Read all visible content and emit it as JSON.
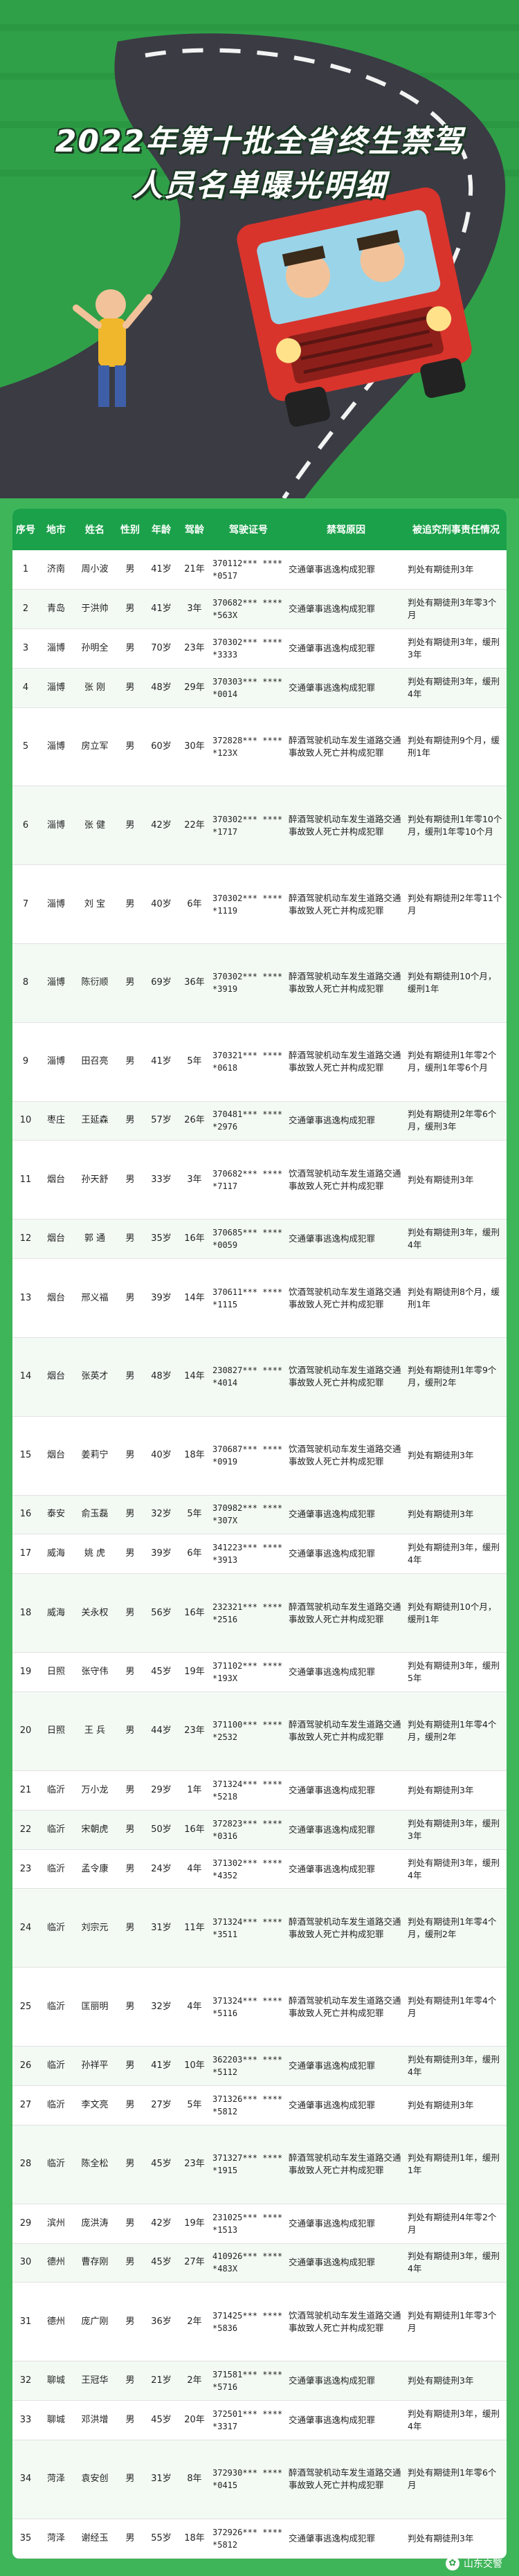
{
  "title": {
    "line1": "2022年第十批全省终生禁驾",
    "line2": "人员名单曝光明细"
  },
  "headers": [
    "序号",
    "地市",
    "姓名",
    "性别",
    "年龄",
    "驾龄",
    "驾驶证号",
    "禁驾原因",
    "被追究刑事责任情况"
  ],
  "rows": [
    [
      "1",
      "济南",
      "周小波",
      "男",
      "41岁",
      "21年",
      "370112*** *****0517",
      "交通肇事逃逸构成犯罪",
      "判处有期徒刑3年"
    ],
    [
      "2",
      "青岛",
      "于洪帅",
      "男",
      "41岁",
      "3年",
      "370682*** *****563X",
      "交通肇事逃逸构成犯罪",
      "判处有期徒刑3年零3个月"
    ],
    [
      "3",
      "淄博",
      "孙明全",
      "男",
      "70岁",
      "23年",
      "370302*** *****3333",
      "交通肇事逃逸构成犯罪",
      "判处有期徒刑3年，缓刑3年"
    ],
    [
      "4",
      "淄博",
      "张 刚",
      "男",
      "48岁",
      "29年",
      "370303*** *****0014",
      "交通肇事逃逸构成犯罪",
      "判处有期徒刑3年，缓刑4年"
    ],
    [
      "5",
      "淄博",
      "房立军",
      "男",
      "60岁",
      "30年",
      "372828*** *****123X",
      "醉酒驾驶机动车发生道路交通事故致人死亡并构成犯罪",
      "判处有期徒刑9个月，缓刑1年"
    ],
    [
      "6",
      "淄博",
      "张 健",
      "男",
      "42岁",
      "22年",
      "370302*** *****1717",
      "醉酒驾驶机动车发生道路交通事故致人死亡并构成犯罪",
      "判处有期徒刑1年零10个月，缓刑1年零10个月"
    ],
    [
      "7",
      "淄博",
      "刘 宝",
      "男",
      "40岁",
      "6年",
      "370302*** *****1119",
      "醉酒驾驶机动车发生道路交通事故致人死亡并构成犯罪",
      "判处有期徒刑2年零11个月"
    ],
    [
      "8",
      "淄博",
      "陈衍顺",
      "男",
      "69岁",
      "36年",
      "370302*** *****3919",
      "醉酒驾驶机动车发生道路交通事故致人死亡并构成犯罪",
      "判处有期徒刑10个月，缓刑1年"
    ],
    [
      "9",
      "淄博",
      "田召亮",
      "男",
      "41岁",
      "5年",
      "370321*** *****0618",
      "醉酒驾驶机动车发生道路交通事故致人死亡并构成犯罪",
      "判处有期徒刑1年零2个月，缓刑1年零6个月"
    ],
    [
      "10",
      "枣庄",
      "王延森",
      "男",
      "57岁",
      "26年",
      "370481*** *****2976",
      "交通肇事逃逸构成犯罪",
      "判处有期徒刑2年零6个月，缓刑3年"
    ],
    [
      "11",
      "烟台",
      "孙天舒",
      "男",
      "33岁",
      "3年",
      "370682*** *****7117",
      "饮酒驾驶机动车发生道路交通事故致人死亡并构成犯罪",
      "判处有期徒刑3年"
    ],
    [
      "12",
      "烟台",
      "郭 通",
      "男",
      "35岁",
      "16年",
      "370685*** *****0059",
      "交通肇事逃逸构成犯罪",
      "判处有期徒刑3年，缓刑4年"
    ],
    [
      "13",
      "烟台",
      "邢义福",
      "男",
      "39岁",
      "14年",
      "370611*** *****1115",
      "饮酒驾驶机动车发生道路交通事故致人死亡并构成犯罪",
      "判处有期徒刑8个月，缓刑1年"
    ],
    [
      "14",
      "烟台",
      "张英才",
      "男",
      "48岁",
      "14年",
      "230827*** *****4014",
      "饮酒驾驶机动车发生道路交通事故致人死亡并构成犯罪",
      "判处有期徒刑1年零9个月，缓刑2年"
    ],
    [
      "15",
      "烟台",
      "姜莉宁",
      "男",
      "40岁",
      "18年",
      "370687*** *****0919",
      "饮酒驾驶机动车发生道路交通事故致人死亡并构成犯罪",
      "判处有期徒刑3年"
    ],
    [
      "16",
      "泰安",
      "俞玉磊",
      "男",
      "32岁",
      "5年",
      "370982*** *****307X",
      "交通肇事逃逸构成犯罪",
      "判处有期徒刑3年"
    ],
    [
      "17",
      "威海",
      "姚 虎",
      "男",
      "39岁",
      "6年",
      "341223*** *****3913",
      "交通肇事逃逸构成犯罪",
      "判处有期徒刑3年，缓刑4年"
    ],
    [
      "18",
      "威海",
      "关永权",
      "男",
      "56岁",
      "16年",
      "232321*** *****2516",
      "醉酒驾驶机动车发生道路交通事故致人死亡并构成犯罪",
      "判处有期徒刑10个月，缓刑1年"
    ],
    [
      "19",
      "日照",
      "张守伟",
      "男",
      "45岁",
      "19年",
      "371102*** *****193X",
      "交通肇事逃逸构成犯罪",
      "判处有期徒刑3年，缓刑5年"
    ],
    [
      "20",
      "日照",
      "王 兵",
      "男",
      "44岁",
      "23年",
      "371100*** *****2532",
      "醉酒驾驶机动车发生道路交通事故致人死亡并构成犯罪",
      "判处有期徒刑1年零4个月，缓刑2年"
    ],
    [
      "21",
      "临沂",
      "万小龙",
      "男",
      "29岁",
      "1年",
      "371324*** *****5218",
      "交通肇事逃逸构成犯罪",
      "判处有期徒刑3年"
    ],
    [
      "22",
      "临沂",
      "宋朝虎",
      "男",
      "50岁",
      "16年",
      "372823*** *****0316",
      "交通肇事逃逸构成犯罪",
      "判处有期徒刑3年，缓刑3年"
    ],
    [
      "23",
      "临沂",
      "孟令康",
      "男",
      "24岁",
      "4年",
      "371302*** *****4352",
      "交通肇事逃逸构成犯罪",
      "判处有期徒刑3年，缓刑4年"
    ],
    [
      "24",
      "临沂",
      "刘宗元",
      "男",
      "31岁",
      "11年",
      "371324*** *****3511",
      "醉酒驾驶机动车发生道路交通事故致人死亡并构成犯罪",
      "判处有期徒刑1年零4个月，缓刑2年"
    ],
    [
      "25",
      "临沂",
      "匡丽明",
      "男",
      "32岁",
      "4年",
      "371324*** *****5116",
      "醉酒驾驶机动车发生道路交通事故致人死亡并构成犯罪",
      "判处有期徒刑1年零4个月"
    ],
    [
      "26",
      "临沂",
      "孙祥平",
      "男",
      "41岁",
      "10年",
      "362203*** *****5112",
      "交通肇事逃逸构成犯罪",
      "判处有期徒刑3年，缓刑4年"
    ],
    [
      "27",
      "临沂",
      "李文亮",
      "男",
      "27岁",
      "5年",
      "371326*** *****5812",
      "交通肇事逃逸构成犯罪",
      "判处有期徒刑3年"
    ],
    [
      "28",
      "临沂",
      "陈全松",
      "男",
      "45岁",
      "23年",
      "371327*** *****1915",
      "醉酒驾驶机动车发生道路交通事故致人死亡并构成犯罪",
      "判处有期徒刑1年，缓刑1年"
    ],
    [
      "29",
      "滨州",
      "庞洪涛",
      "男",
      "42岁",
      "19年",
      "231025*** *****1513",
      "交通肇事逃逸构成犯罪",
      "判处有期徒刑4年零2个月"
    ],
    [
      "30",
      "德州",
      "曹存刚",
      "男",
      "45岁",
      "27年",
      "410926*** *****483X",
      "交通肇事逃逸构成犯罪",
      "判处有期徒刑3年，缓刑4年"
    ],
    [
      "31",
      "德州",
      "庞广刚",
      "男",
      "36岁",
      "2年",
      "371425*** *****5836",
      "饮酒驾驶机动车发生道路交通事故致人死亡并构成犯罪",
      "判处有期徒刑1年零3个月"
    ],
    [
      "32",
      "聊城",
      "王冠华",
      "男",
      "21岁",
      "2年",
      "371581*** *****5716",
      "交通肇事逃逸构成犯罪",
      "判处有期徒刑3年"
    ],
    [
      "33",
      "聊城",
      "邓洪增",
      "男",
      "45岁",
      "20年",
      "372501*** *****3317",
      "交通肇事逃逸构成犯罪",
      "判处有期徒刑3年，缓刑4年"
    ],
    [
      "34",
      "菏泽",
      "袁安创",
      "男",
      "31岁",
      "8年",
      "372930*** *****0415",
      "醉酒驾驶机动车发生道路交通事故致人死亡并构成犯罪",
      "判处有期徒刑1年零6个月"
    ],
    [
      "35",
      "菏泽",
      "谢经玉",
      "男",
      "55岁",
      "18年",
      "372926*** *****5812",
      "交通肇事逃逸构成犯罪",
      "判处有期徒刑3年"
    ]
  ],
  "footer": {
    "source": "山东交警"
  },
  "colors": {
    "header": "#1aa14a",
    "background": "#3fb55a"
  }
}
